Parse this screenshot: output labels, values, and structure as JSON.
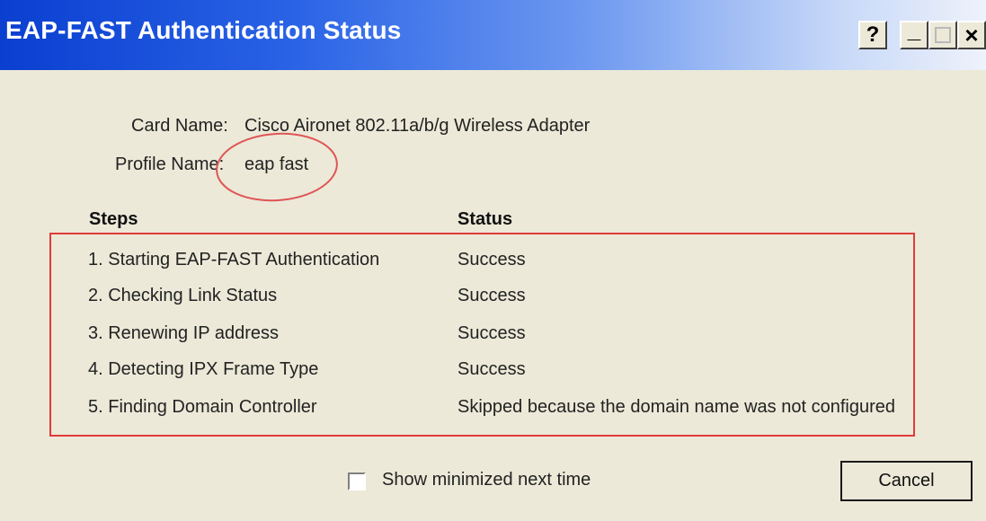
{
  "window": {
    "title": "EAP-FAST Authentication Status",
    "controls": {
      "help": "?",
      "minimize": "_",
      "close": "×"
    }
  },
  "info": {
    "card_label": "Card Name:",
    "card_value": "Cisco Aironet 802.11a/b/g Wireless Adapter",
    "profile_label": "Profile Name:",
    "profile_value": "eap fast"
  },
  "table": {
    "headers": {
      "steps": "Steps",
      "status": "Status"
    },
    "rows": [
      {
        "step": "1. Starting EAP-FAST Authentication",
        "status": "Success"
      },
      {
        "step": "2. Checking Link Status",
        "status": "Success"
      },
      {
        "step": "3. Renewing IP address",
        "status": "Success"
      },
      {
        "step": "4. Detecting IPX Frame Type",
        "status": "Success"
      },
      {
        "step": "5. Finding Domain Controller",
        "status": "Skipped because the domain name was not configured"
      }
    ]
  },
  "footer": {
    "checkbox_label": "Show minimized next time",
    "checkbox_checked": false,
    "cancel_label": "Cancel"
  },
  "colors": {
    "highlight": "#e03a3a",
    "titlebar": "#0a3fd0",
    "background": "#ece9d8"
  }
}
